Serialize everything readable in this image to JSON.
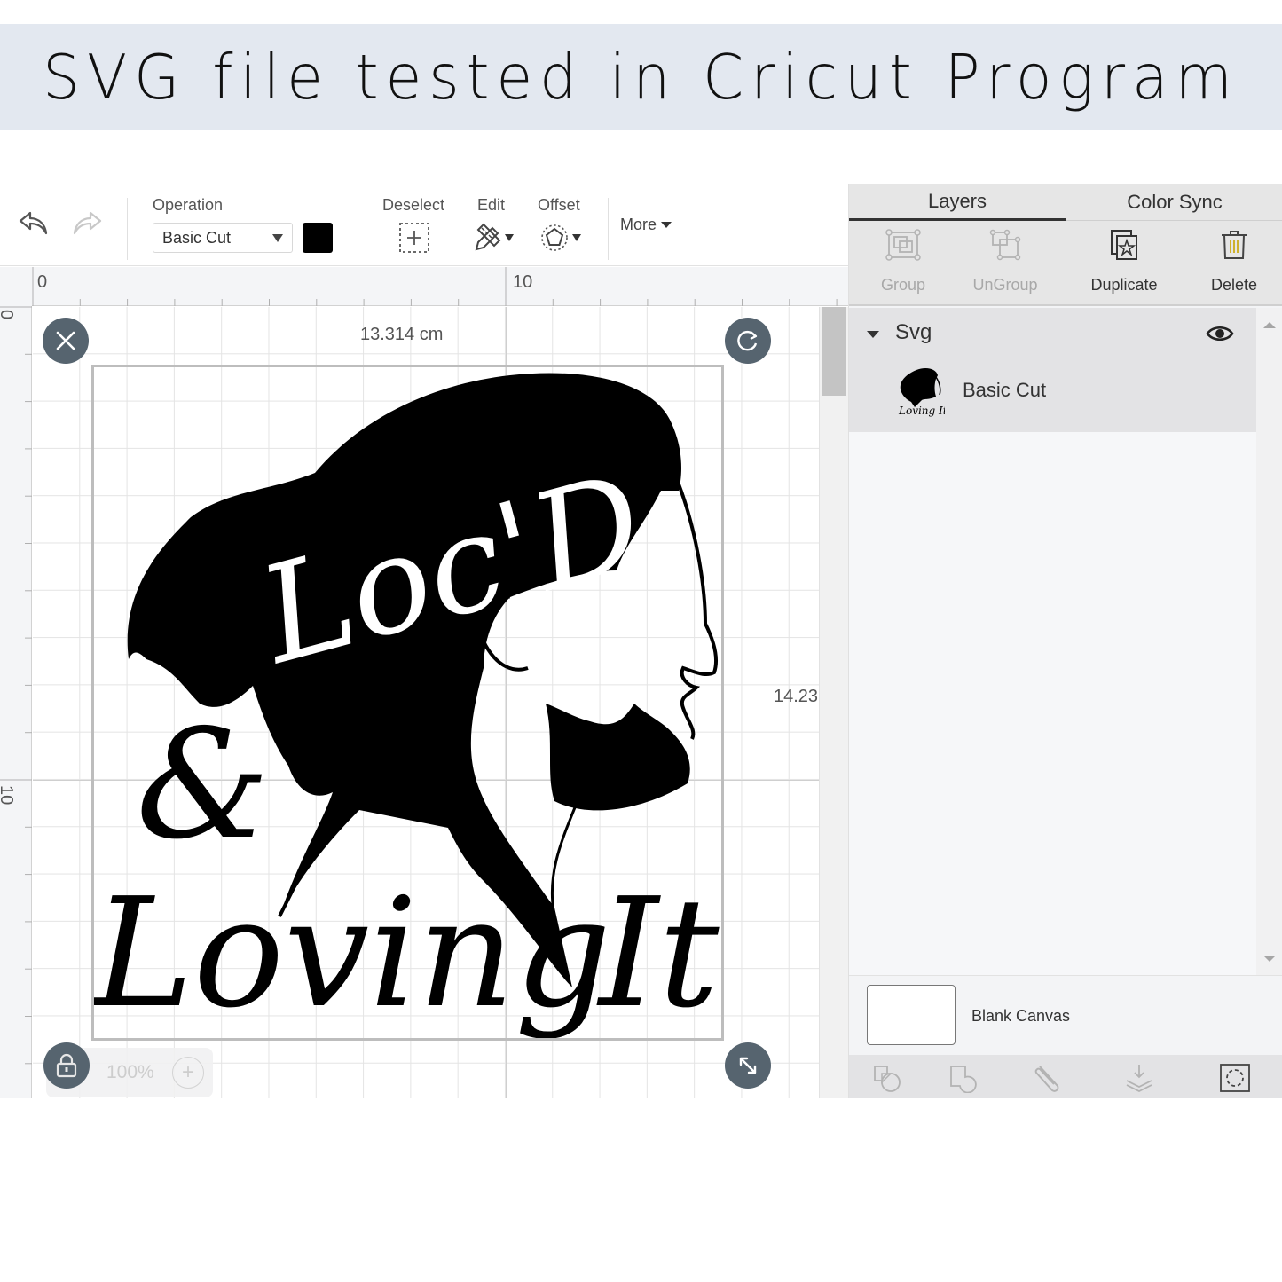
{
  "banner": {
    "title": "SVG file tested in Cricut Program"
  },
  "toolbar": {
    "undo_icon": "undo-icon",
    "redo_icon": "redo-icon",
    "operation_label": "Operation",
    "operation_value": "Basic Cut",
    "operation_color": "#000000",
    "deselect_label": "Deselect",
    "edit_label": "Edit",
    "offset_label": "Offset",
    "more_label": "More"
  },
  "rulers": {
    "top": [
      "0",
      "10"
    ],
    "left": [
      "0",
      "10"
    ]
  },
  "canvas": {
    "width_label": "13.314 cm",
    "height_label": "14.23",
    "zoom": "100%",
    "zoom_plus": "+",
    "artwork": {
      "line1": "Loc'D",
      "line2": "&",
      "line3": "Loving",
      "line4": "It"
    }
  },
  "panel": {
    "tabs": [
      {
        "label": "Layers",
        "active": true
      },
      {
        "label": "Color Sync",
        "active": false
      }
    ],
    "actions": [
      {
        "label": "Group",
        "enabled": false
      },
      {
        "label": "UnGroup",
        "enabled": false
      },
      {
        "label": "Duplicate",
        "enabled": true
      },
      {
        "label": "Delete",
        "enabled": true
      }
    ],
    "layers": {
      "group_name": "Svg",
      "items": [
        {
          "name": "Basic Cut"
        }
      ]
    },
    "blank_canvas_label": "Blank Canvas"
  }
}
